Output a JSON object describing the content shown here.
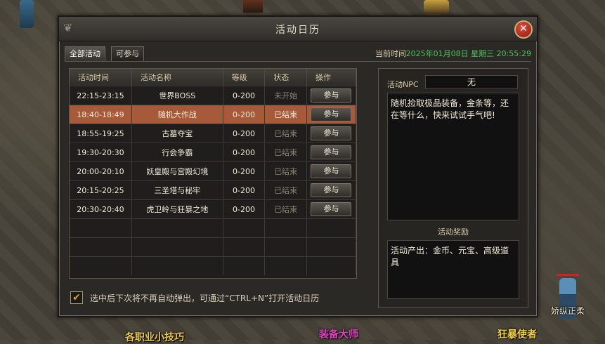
{
  "window": {
    "title": "活动日历",
    "close_glyph": "✕"
  },
  "tabs": [
    {
      "label": "全部活动"
    },
    {
      "label": "可参与"
    }
  ],
  "current_time": {
    "label": "当前时间",
    "value": "2025年01月08日 星期三 20:55:29"
  },
  "table": {
    "headers": [
      "活动时间",
      "活动名称",
      "等级",
      "状态",
      "操作"
    ],
    "rows": [
      {
        "time": "22:15-23:15",
        "name": "世界BOSS",
        "level": "0-200",
        "status": "未开始",
        "action": "参与"
      },
      {
        "time": "18:40-18:49",
        "name": "随机大作战",
        "level": "0-200",
        "status": "已结束",
        "action": "参与"
      },
      {
        "time": "18:55-19:25",
        "name": "古墓夺宝",
        "level": "0-200",
        "status": "已结束",
        "action": "参与"
      },
      {
        "time": "19:30-20:30",
        "name": "行会争霸",
        "level": "0-200",
        "status": "已结束",
        "action": "参与"
      },
      {
        "time": "20:00-20:10",
        "name": "妖皇殿与宫殿幻境",
        "level": "0-200",
        "status": "已结束",
        "action": "参与"
      },
      {
        "time": "20:15-20:25",
        "name": "三圣塔与秘牢",
        "level": "0-200",
        "status": "已结束",
        "action": "参与"
      },
      {
        "time": "20:30-20:40",
        "name": "虎卫岭与狂暴之地",
        "level": "0-200",
        "status": "已结束",
        "action": "参与"
      }
    ],
    "selected_row": 1
  },
  "npc": {
    "label": "活动NPC",
    "value": "无"
  },
  "description": "随机捡取极品装备，金条等，还在等什么，快来试试手气吧!",
  "reward": {
    "title": "活动奖励",
    "text": "活动产出：金币、元宝、高级道具"
  },
  "auto_popup": {
    "checked": true,
    "check_glyph": "✔",
    "label": "选中后下次将不再自动弹出，可通过“CTRL+N”打开活动日历"
  },
  "scene": {
    "player_name": "娇纵正柔",
    "signs": [
      {
        "text": "各职业小技巧",
        "color": "#e8c84a"
      },
      {
        "text": "装备大师",
        "color": "#e040c0"
      },
      {
        "text": "狂暴使者",
        "color": "#f0d040"
      }
    ]
  },
  "colors": {
    "accent_green": "#4ec35a",
    "selected_row": "#a65a3a",
    "close_red": "#c02820"
  }
}
